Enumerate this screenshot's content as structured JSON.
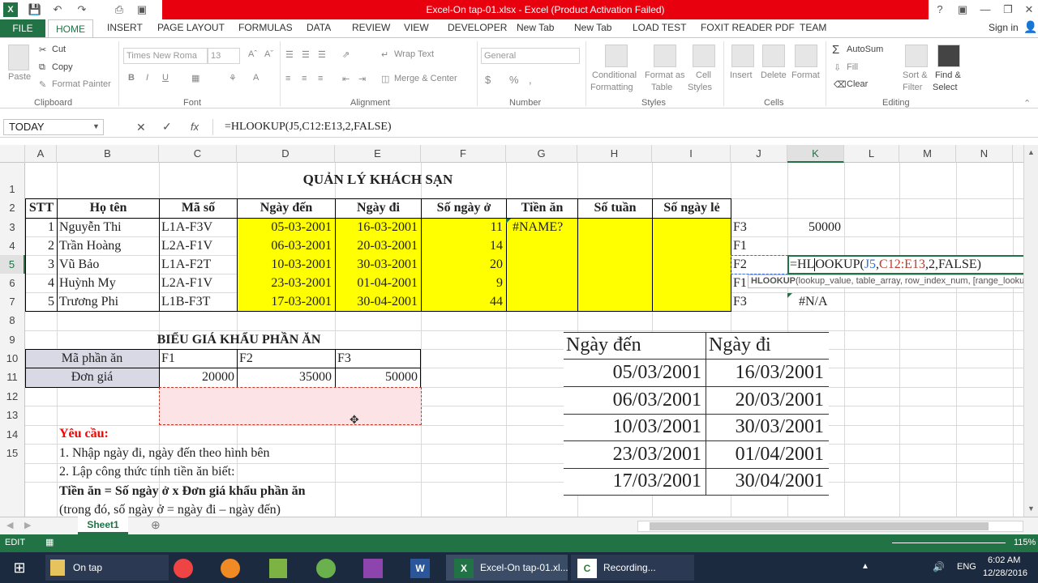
{
  "window": {
    "title": "Excel-On tap-01.xlsx -  Excel (Product Activation Failed)",
    "help": "?",
    "sign_in": "Sign in"
  },
  "menu": {
    "file": "FILE",
    "tabs": [
      "HOME",
      "INSERT",
      "PAGE LAYOUT",
      "FORMULAS",
      "DATA",
      "REVIEW",
      "VIEW",
      "DEVELOPER",
      "New Tab",
      "New Tab",
      "LOAD TEST",
      "FOXIT READER PDF",
      "TEAM"
    ]
  },
  "ribbon": {
    "clipboard": {
      "paste": "Paste",
      "cut": "Cut",
      "copy": "Copy",
      "format_painter": "Format Painter",
      "label": "Clipboard"
    },
    "font": {
      "name": "Times New Roma",
      "size": "13",
      "label": "Font"
    },
    "alignment": {
      "wrap": "Wrap Text",
      "merge": "Merge & Center",
      "label": "Alignment"
    },
    "number": {
      "format": "General",
      "label": "Number"
    },
    "styles": {
      "conditional": "Conditional",
      "formatting": "Formatting",
      "format_as": "Format as",
      "table": "Table",
      "cell": "Cell",
      "cell_styles": "Styles",
      "label": "Styles"
    },
    "cells": {
      "insert": "Insert",
      "delete": "Delete",
      "format": "Format",
      "label": "Cells"
    },
    "editing": {
      "autosum": "AutoSum",
      "fill": "Fill",
      "clear": "Clear",
      "sort": "Sort &",
      "filter": "Filter",
      "find": "Find &",
      "select": "Select",
      "label": "Editing"
    }
  },
  "formula_bar": {
    "name_box": "TODAY",
    "formula": "=HLOOKUP(J5,C12:E13,2,FALSE)"
  },
  "columns": [
    "A",
    "B",
    "C",
    "D",
    "E",
    "F",
    "G",
    "H",
    "I",
    "J",
    "K",
    "L",
    "M",
    "N"
  ],
  "rows": [
    "1",
    "2",
    "3",
    "4",
    "5",
    "6",
    "7",
    "8",
    "9",
    "10",
    "11",
    "12",
    "13",
    "14",
    "15"
  ],
  "sheet": {
    "title": "QUẢN LÝ KHÁCH SẠN",
    "headers": [
      "STT",
      "Họ tên",
      "Mã số",
      "Ngày đến",
      "Ngày đi",
      "Số ngày ở",
      "Tiền ăn",
      "Số tuần",
      "Số ngày lẻ"
    ],
    "records": [
      {
        "stt": "1",
        "name": "Nguyễn Thi",
        "code": "L1A-F3V",
        "arrive": "05-03-2001",
        "leave": "16-03-2001",
        "days": "11",
        "food": "#NAME?"
      },
      {
        "stt": "2",
        "name": "Trần Hoàng",
        "code": "L2A-F1V",
        "arrive": "06-03-2001",
        "leave": "20-03-2001",
        "days": "14",
        "food": ""
      },
      {
        "stt": "3",
        "name": "Vũ Bảo",
        "code": "L1A-F2T",
        "arrive": "10-03-2001",
        "leave": "30-03-2001",
        "days": "20",
        "food": ""
      },
      {
        "stt": "4",
        "name": "Huỳnh My",
        "code": "L2A-F1V",
        "arrive": "23-03-2001",
        "leave": "01-04-2001",
        "days": "9",
        "food": ""
      },
      {
        "stt": "5",
        "name": "Trương Phi",
        "code": "L1B-F3T",
        "arrive": "17-03-2001",
        "leave": "30-04-2001",
        "days": "44",
        "food": ""
      }
    ],
    "side": {
      "j3": "F3",
      "k3": "50000",
      "j4": "F1",
      "j5": "F2",
      "k5_parts": {
        "eq": "=HL",
        "rest": "OOKUP(",
        "ref1": "J5",
        ",": ",",
        "ref2": "C12:E13",
        "tail": ",2,FALSE)"
      },
      "j6": "F1",
      "j7": "F3",
      "k7": "#N/A"
    },
    "tooltip": {
      "fn": "HLOOKUP",
      "args": "(lookup_value, table_array, row_index_num, [range_lookup])"
    },
    "price_title": "BIỂU GIÁ KHẨU PHẦN ĂN",
    "price": {
      "row10_label": "Mã phần ăn",
      "row11_label": "Đơn giá",
      "codes": [
        "F1",
        "F2",
        "F3"
      ],
      "prices": [
        "20000",
        "35000",
        "50000"
      ]
    },
    "notes": {
      "heading": "Yêu cầu:",
      "l1": "1. Nhập ngày đi, ngày đến theo hình bên",
      "l2": "2. Lập công thức tính tiền ăn biết:",
      "l3": "Tiền ăn = Số ngày ở x Đơn giá khẩu phần ăn",
      "l4": "(trong đó, số ngày ở = ngày đi – ngày đến)"
    },
    "dates_table": {
      "h1": "Ngày đến",
      "h2": "Ngày đi",
      "rows": [
        [
          "05/03/2001",
          "16/03/2001"
        ],
        [
          "06/03/2001",
          "20/03/2001"
        ],
        [
          "10/03/2001",
          "30/03/2001"
        ],
        [
          "23/03/2001",
          "01/04/2001"
        ],
        [
          "17/03/2001",
          "30/04/2001"
        ]
      ]
    }
  },
  "sheet_tab": "Sheet1",
  "status": {
    "mode": "EDIT",
    "zoom": "115%"
  },
  "taskbar": {
    "items": [
      "On tap",
      "Excel-On tap-01.xl...",
      "Recording..."
    ],
    "lang": "ENG",
    "time": "6:02 AM",
    "date": "12/28/2016"
  },
  "colors": {
    "excel_green": "#217346",
    "title_red": "#e8000e",
    "yellow": "#ffff00",
    "error_red": "#ff0000"
  }
}
